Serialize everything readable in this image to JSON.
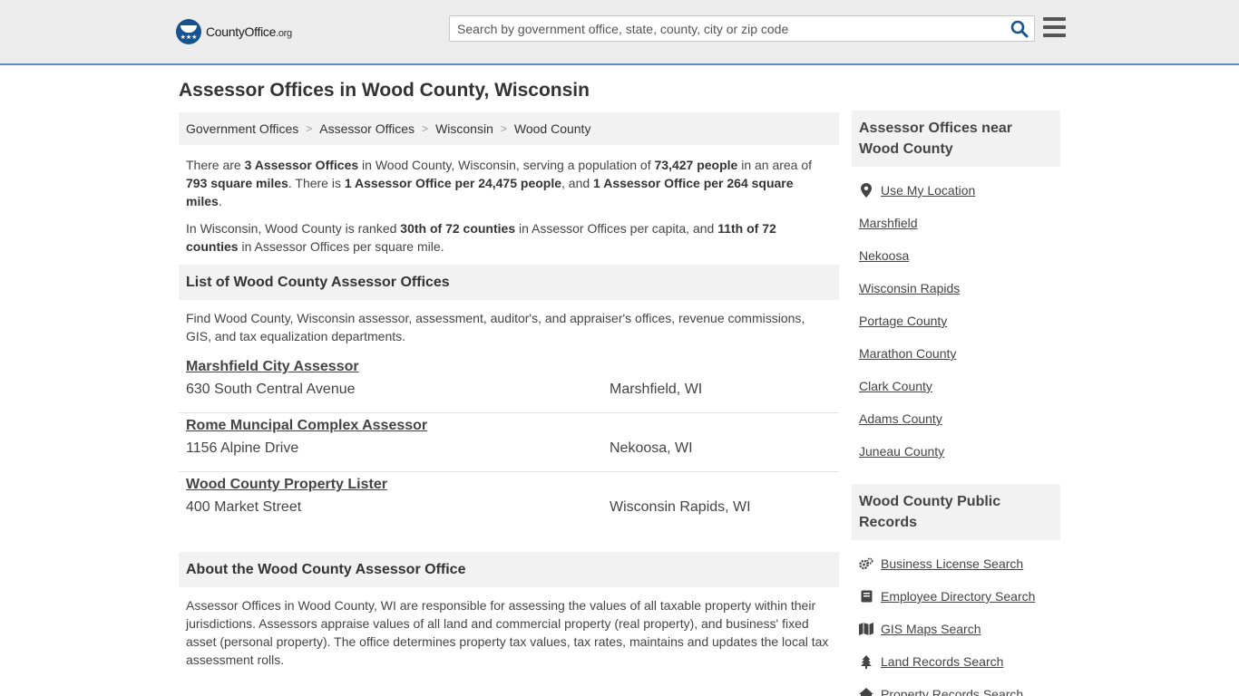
{
  "header": {
    "logo_main": "CountyOffice",
    "logo_org": ".org",
    "logo_stars": "★★★",
    "search_placeholder": "Search by government office, state, county, city or zip code"
  },
  "page_title": "Assessor Offices in Wood County, Wisconsin",
  "breadcrumb": [
    "Government Offices",
    "Assessor Offices",
    "Wisconsin",
    "Wood County"
  ],
  "intro": {
    "p1": {
      "t1": "There are ",
      "b1": "3 Assessor Offices",
      "t2": " in Wood County, Wisconsin, serving a population of ",
      "b2": "73,427 people",
      "t3": " in an area of ",
      "b3": "793 square miles",
      "t4": ". There is ",
      "b4": "1 Assessor Office per 24,475 people",
      "t5": ", and ",
      "b5": "1 Assessor Office per 264 square miles",
      "t6": "."
    },
    "p2": {
      "t1": "In Wisconsin, Wood County is ranked ",
      "b1": "30th of 72 counties",
      "t2": " in Assessor Offices per capita, and ",
      "b2": "11th of 72 counties",
      "t3": " in Assessor Offices per square mile."
    }
  },
  "list_section": {
    "heading": "List of Wood County Assessor Offices",
    "description": "Find Wood County, Wisconsin assessor, assessment, auditor's, and appraiser's offices, revenue commissions, GIS, and tax equalization departments.",
    "offices": [
      {
        "name": "Marshfield City Assessor",
        "address": "630 South Central Avenue",
        "city": "Marshfield, WI"
      },
      {
        "name": "Rome Muncipal Complex Assessor",
        "address": "1156 Alpine Drive",
        "city": "Nekoosa, WI"
      },
      {
        "name": "Wood County Property Lister",
        "address": "400 Market Street",
        "city": "Wisconsin Rapids, WI"
      }
    ]
  },
  "about_section": {
    "heading": "About the Wood County Assessor Office",
    "text": "Assessor Offices in Wood County, WI are responsible for assessing the values of all taxable property within their jurisdictions. Assessors appraise values of all land and commercial property (real property), and business' fixed asset (personal property). The office determines property tax values, tax rates, maintains and updates the local tax assessment rolls."
  },
  "sidebar": {
    "nearby": {
      "heading": "Assessor Offices near Wood County",
      "use_location": "Use My Location",
      "items": [
        "Marshfield",
        "Nekoosa",
        "Wisconsin Rapids",
        "Portage County",
        "Marathon County",
        "Clark County",
        "Adams County",
        "Juneau County"
      ]
    },
    "records": {
      "heading": "Wood County Public Records",
      "items": [
        {
          "label": "Business License Search",
          "icon": "gears-icon"
        },
        {
          "label": "Employee Directory Search",
          "icon": "book-icon"
        },
        {
          "label": "GIS Maps Search",
          "icon": "map-icon"
        },
        {
          "label": "Land Records Search",
          "icon": "tree-icon"
        },
        {
          "label": "Property Records Search",
          "icon": "house-icon"
        }
      ]
    }
  },
  "colors": {
    "accent": "#17538f",
    "header_bg": "#ececec",
    "header_border": "#5b8fc7",
    "panel_bg": "#f2f2f2"
  }
}
